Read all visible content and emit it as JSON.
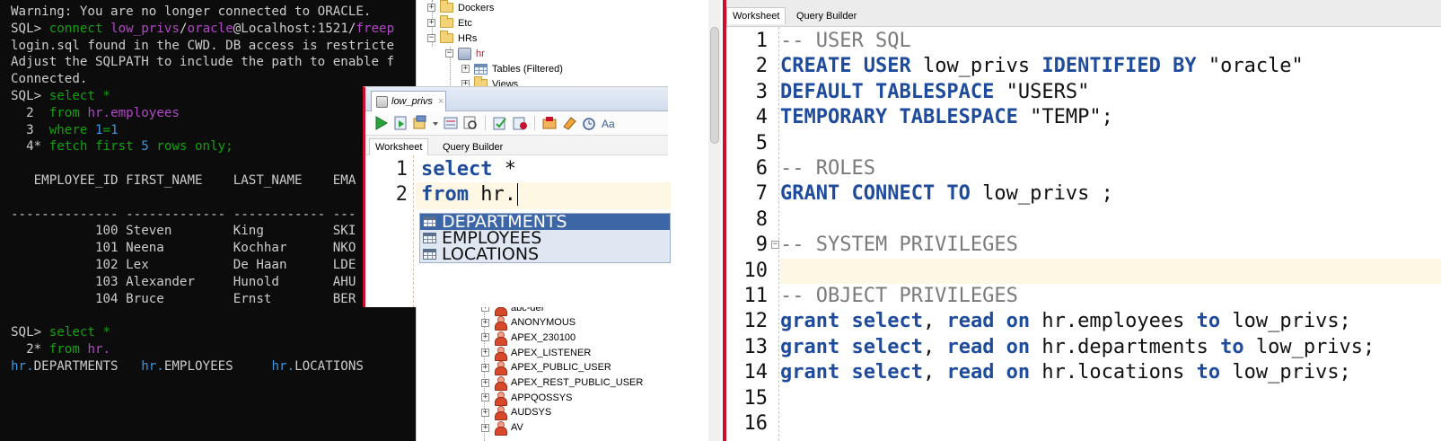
{
  "terminal": {
    "lines": [
      [
        {
          "t": "Warning: You are no longer connected to ORACLE.",
          "c": "w"
        }
      ],
      [
        {
          "t": "SQL> ",
          "c": "w"
        },
        {
          "t": "connect ",
          "c": "g"
        },
        {
          "t": "low_privs",
          "c": "m"
        },
        {
          "t": "/",
          "c": "w"
        },
        {
          "t": "oracle",
          "c": "m"
        },
        {
          "t": "@Localhost:1521/",
          "c": "w"
        },
        {
          "t": "freep",
          "c": "m"
        }
      ],
      [
        {
          "t": "login.sql found in the CWD. DB access is restricte",
          "c": "w"
        }
      ],
      [
        {
          "t": "Adjust the SQLPATH to include the path to enable f",
          "c": "w"
        }
      ],
      [
        {
          "t": "Connected.",
          "c": "w"
        }
      ],
      [
        {
          "t": "SQL> ",
          "c": "w"
        },
        {
          "t": "select *",
          "c": "g"
        }
      ],
      [
        {
          "t": "  2  ",
          "c": "w"
        },
        {
          "t": "from ",
          "c": "g"
        },
        {
          "t": "hr",
          "c": "m"
        },
        {
          "t": ".employees",
          "c": "m"
        }
      ],
      [
        {
          "t": "  3  ",
          "c": "w"
        },
        {
          "t": "where ",
          "c": "g"
        },
        {
          "t": "1",
          "c": "c"
        },
        {
          "t": "=",
          "c": "g"
        },
        {
          "t": "1",
          "c": "c"
        }
      ],
      [
        {
          "t": "  4* ",
          "c": "w"
        },
        {
          "t": "fetch first ",
          "c": "g"
        },
        {
          "t": "5",
          "c": "c"
        },
        {
          "t": " rows only;",
          "c": "g"
        }
      ],
      [
        {
          "t": "",
          "c": "w"
        }
      ],
      [
        {
          "t": "   EMPLOYEE_ID FIRST_NAME    LAST_NAME    EMA",
          "c": "w"
        }
      ],
      [
        {
          "t": "",
          "c": "w"
        }
      ],
      [
        {
          "t": "-------------- ------------- ------------ ---",
          "c": "w"
        }
      ],
      [
        {
          "t": "           100 Steven        King         SKI",
          "c": "w"
        }
      ],
      [
        {
          "t": "           101 Neena         Kochhar      NKO",
          "c": "w"
        }
      ],
      [
        {
          "t": "           102 Lex           De Haan      LDE",
          "c": "w"
        }
      ],
      [
        {
          "t": "           103 Alexander     Hunold       AHU",
          "c": "w"
        }
      ],
      [
        {
          "t": "           104 Bruce         Ernst        BER",
          "c": "w"
        }
      ],
      [
        {
          "t": "",
          "c": "w"
        }
      ],
      [
        {
          "t": "SQL> ",
          "c": "w"
        },
        {
          "t": "select *",
          "c": "g"
        }
      ],
      [
        {
          "t": "  2* ",
          "c": "w"
        },
        {
          "t": "from ",
          "c": "g"
        },
        {
          "t": "hr.",
          "c": "m"
        }
      ],
      [
        {
          "t": "hr.",
          "c": "c"
        },
        {
          "t": "DEPARTMENTS   ",
          "c": "w"
        },
        {
          "t": "hr.",
          "c": "c"
        },
        {
          "t": "EMPLOYEES     ",
          "c": "w"
        },
        {
          "t": "hr.",
          "c": "c"
        },
        {
          "t": "LOCATIONS",
          "c": "w"
        }
      ]
    ]
  },
  "tree": {
    "top_items": [
      "Dockers",
      "Etc",
      "HRs"
    ],
    "connection": "hr",
    "children": [
      "Tables (Filtered)",
      "Views"
    ],
    "users": [
      "abc-def",
      "ANONYMOUS",
      "APEX_230100",
      "APEX_LISTENER",
      "APEX_PUBLIC_USER",
      "APEX_REST_PUBLIC_USER",
      "APPQOSSYS",
      "AUDSYS",
      "AV"
    ]
  },
  "popup": {
    "tab_title": "low_privs",
    "subtabs": [
      "Worksheet",
      "Query Builder"
    ],
    "line_numbers": [
      "1",
      "2"
    ],
    "code_line1_kw": "select",
    "code_line1_rest": " *",
    "code_line2_kw": "from",
    "code_line2_rest": " hr.",
    "autocomplete": [
      "DEPARTMENTS",
      "EMPLOYEES",
      "LOCATIONS"
    ],
    "selected_index": 0
  },
  "worksheet": {
    "subtabs": [
      "Worksheet",
      "Query Builder"
    ],
    "lines": [
      [
        {
          "t": "-- USER SQL",
          "c": "cmt"
        }
      ],
      [
        {
          "t": "CREATE USER",
          "c": "kw"
        },
        {
          "t": " low_privs ",
          "c": "str"
        },
        {
          "t": "IDENTIFIED BY",
          "c": "kw"
        },
        {
          "t": " \"oracle\"",
          "c": "str"
        }
      ],
      [
        {
          "t": "DEFAULT TABLESPACE",
          "c": "kw"
        },
        {
          "t": " \"USERS\"",
          "c": "str"
        }
      ],
      [
        {
          "t": "TEMPORARY TABLESPACE",
          "c": "kw"
        },
        {
          "t": " \"TEMP\";",
          "c": "str"
        }
      ],
      [
        {
          "t": "",
          "c": "str"
        }
      ],
      [
        {
          "t": "-- ROLES",
          "c": "cmt"
        }
      ],
      [
        {
          "t": "GRANT CONNECT TO",
          "c": "kw"
        },
        {
          "t": " low_privs ;",
          "c": "str"
        }
      ],
      [
        {
          "t": "",
          "c": "str"
        }
      ],
      [
        {
          "t": "-- SYSTEM PRIVILEGES",
          "c": "cmt"
        }
      ],
      [
        {
          "t": "",
          "c": "str"
        }
      ],
      [
        {
          "t": "-- OBJECT PRIVILEGES",
          "c": "cmt"
        }
      ],
      [
        {
          "t": "grant select",
          "c": "kw"
        },
        {
          "t": ", ",
          "c": "str"
        },
        {
          "t": "read on",
          "c": "kw"
        },
        {
          "t": " hr.employees ",
          "c": "str"
        },
        {
          "t": "to",
          "c": "kw"
        },
        {
          "t": " low_privs;",
          "c": "str"
        }
      ],
      [
        {
          "t": "grant select",
          "c": "kw"
        },
        {
          "t": ", ",
          "c": "str"
        },
        {
          "t": "read on",
          "c": "kw"
        },
        {
          "t": " hr.departments ",
          "c": "str"
        },
        {
          "t": "to",
          "c": "kw"
        },
        {
          "t": " low_privs;",
          "c": "str"
        }
      ],
      [
        {
          "t": "grant select",
          "c": "kw"
        },
        {
          "t": ", ",
          "c": "str"
        },
        {
          "t": "read on",
          "c": "kw"
        },
        {
          "t": " hr.locations ",
          "c": "str"
        },
        {
          "t": "to",
          "c": "kw"
        },
        {
          "t": " low_privs;",
          "c": "str"
        }
      ],
      [
        {
          "t": "",
          "c": "str"
        }
      ],
      [
        {
          "t": "",
          "c": "str"
        }
      ]
    ],
    "highlight_line": 10
  }
}
